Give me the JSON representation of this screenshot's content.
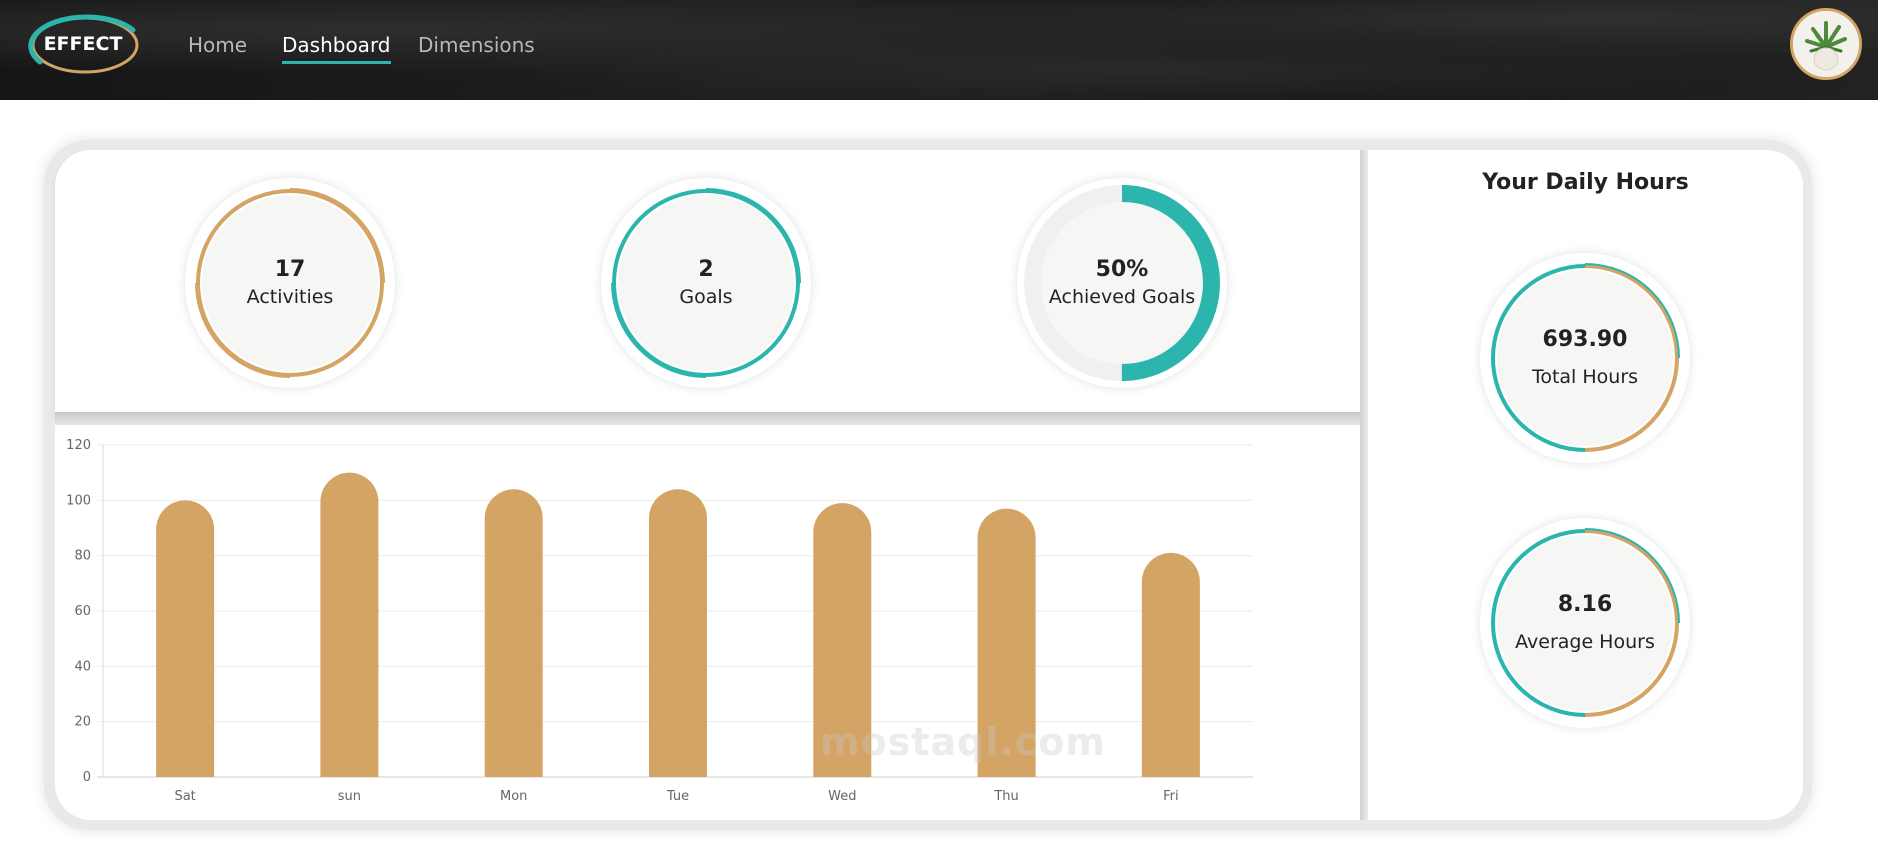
{
  "nav": {
    "logo": "EFFECT",
    "links": [
      {
        "label": "Home",
        "active": false
      },
      {
        "label": "Dashboard",
        "active": true
      },
      {
        "label": "Dimensions",
        "active": false
      }
    ]
  },
  "stats": {
    "activities": {
      "value": "17",
      "label": "Activities"
    },
    "goals": {
      "value": "2",
      "label": "Goals"
    },
    "achieved": {
      "value": "50%",
      "label": "Achieved Goals",
      "progress": 0.5
    }
  },
  "daily": {
    "title": "Your Daily Hours",
    "total": {
      "value": "693.90",
      "label": "Total Hours"
    },
    "average": {
      "value": "8.16",
      "label": "Average Hours"
    }
  },
  "colors": {
    "gold": "#d4a464",
    "teal": "#2bb5ad"
  },
  "chart_data": {
    "type": "bar",
    "categories": [
      "Sat",
      "sun",
      "Mon",
      "Tue",
      "Wed",
      "Thu",
      "Fri"
    ],
    "values": [
      100,
      110,
      104,
      104,
      99,
      97,
      81
    ],
    "ylim": [
      0,
      120
    ],
    "yticks": [
      0,
      20,
      40,
      60,
      80,
      100,
      120
    ],
    "title": "",
    "xlabel": "",
    "ylabel": "",
    "grid": true,
    "bar_color": "#d4a464"
  },
  "watermark": "mostaql.com"
}
